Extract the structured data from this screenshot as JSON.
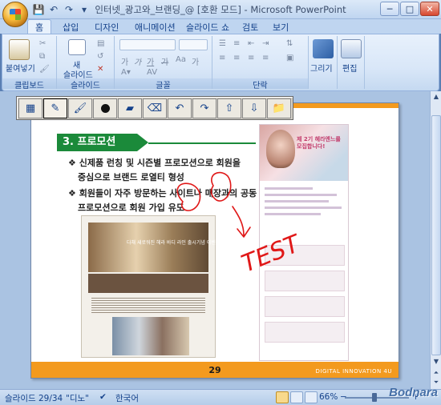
{
  "window": {
    "title": "인터넷_광고와_브랜딩_@ [호환 모드] - Microsoft PowerPoint",
    "minimize": "─",
    "maximize": "□",
    "close": "✕"
  },
  "quick_access": {
    "save": "💾",
    "undo": "↶",
    "redo": "↷",
    "more": "▾"
  },
  "tabs": [
    {
      "label": "홈",
      "active": true
    },
    {
      "label": "삽입"
    },
    {
      "label": "디자인"
    },
    {
      "label": "애니메이션"
    },
    {
      "label": "슬라이드 쇼"
    },
    {
      "label": "검토"
    },
    {
      "label": "보기"
    }
  ],
  "ribbon": {
    "clipboard": {
      "paste": "붙여넣기",
      "label": "클립보드"
    },
    "slides": {
      "new": "새",
      "new2": "슬라이드",
      "label": "슬라이드"
    },
    "font": {
      "label": "글꼴",
      "bold": "가",
      "italic": "가",
      "grow": "가",
      "shrink": "가",
      "case": "Aa",
      "clear": "가"
    },
    "paragraph": {
      "label": "단락"
    },
    "drawing": {
      "label": "그리기"
    },
    "editing": {
      "label": "편집"
    }
  },
  "slide": {
    "section_title": "3. 프로모션",
    "bullets": [
      {
        "sym": "❖",
        "line1": "신제품 런칭 및 시즌별 프로모션으로 회원을",
        "line2": "중심으로 브랜드 로열티 형성"
      },
      {
        "sym": "❖",
        "line1": "회원들이 자주 방문하는 사이트나 매장과의 공동",
        "line2": "프로모션으로 회원 가입 유도"
      }
    ],
    "shot_banner_text": "다채 새로워진 헤라 바디 라인 출시기념 이벤트",
    "poster_title": "제 2기 헤라엔느를 모집합니다!",
    "page_number": "29",
    "footer": "DIGITAL INNOVATION 4U",
    "ink_text": "TEST"
  },
  "pen_toolbar": {
    "tools": [
      {
        "name": "slide-sorter-tool-icon",
        "glyph": "▦"
      },
      {
        "name": "pen-tool-icon",
        "glyph": "✎",
        "selected": true
      },
      {
        "name": "brush-tool-icon",
        "glyph": "🖌"
      },
      {
        "name": "dot-tool-icon",
        "glyph": "●"
      },
      {
        "name": "highlighter-tool-icon",
        "glyph": "▰"
      },
      {
        "name": "eraser-tool-icon",
        "glyph": "⌫"
      },
      {
        "name": "undo-arrow-icon",
        "glyph": "↶"
      },
      {
        "name": "redo-arrow-icon",
        "glyph": "↷"
      },
      {
        "name": "page-up-icon",
        "glyph": "⇧"
      },
      {
        "name": "page-down-icon",
        "glyph": "⇩"
      },
      {
        "name": "folder-icon",
        "glyph": "📁"
      }
    ]
  },
  "status": {
    "slide": "슬라이드 29/34",
    "theme": "\"디노\"",
    "language": "한국어",
    "zoom": "66%",
    "zoom_minus": "−",
    "zoom_plus": "+"
  },
  "watermark": "Bodnara",
  "colors": {
    "accent_orange": "#f39a1e",
    "section_green": "#1b8a3a",
    "ink_red": "#e01818"
  }
}
